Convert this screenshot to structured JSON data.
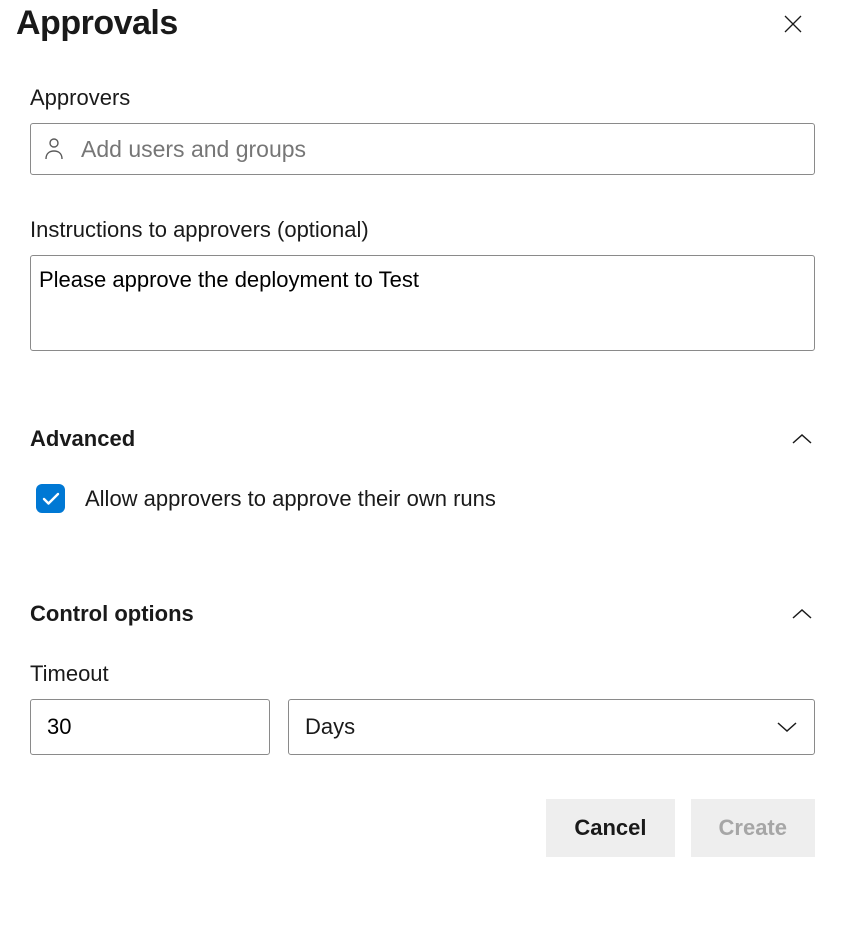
{
  "header": {
    "title": "Approvals"
  },
  "approvers": {
    "label": "Approvers",
    "placeholder": "Add users and groups",
    "value": ""
  },
  "instructions": {
    "label": "Instructions to approvers (optional)",
    "value": "Please approve the deployment to Test"
  },
  "advanced": {
    "title": "Advanced",
    "allow_own_label": "Allow approvers to approve their own runs",
    "allow_own_checked": true
  },
  "control": {
    "title": "Control options",
    "timeout_label": "Timeout",
    "timeout_value": "30",
    "timeout_unit": "Days"
  },
  "footer": {
    "cancel": "Cancel",
    "create": "Create"
  },
  "colors": {
    "accent": "#0078d4"
  }
}
